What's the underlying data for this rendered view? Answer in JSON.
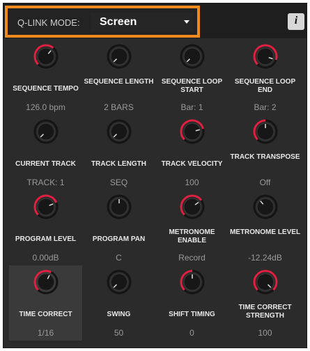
{
  "header": {
    "mode_label": "Q-LINK MODE:",
    "mode_value": "Screen",
    "info_label": "i"
  },
  "colors": {
    "highlight": "#f08a1d",
    "knob_active": "#e02040",
    "panel_bg": "#2b2b2b"
  },
  "knobs": [
    {
      "label": "SEQUENCE TEMPO",
      "value": "126.0 bpm",
      "level": 0.65,
      "red": true
    },
    {
      "label": "SEQUENCE LENGTH",
      "value": "2 BARS",
      "level": 0.0,
      "red": false
    },
    {
      "label": "SEQUENCE LOOP START",
      "value": "Bar: 1",
      "level": 0.0,
      "red": false
    },
    {
      "label": "SEQUENCE LOOP END",
      "value": "Bar: 2",
      "level": 0.9,
      "red": true
    },
    {
      "label": "CURRENT TRACK",
      "value": "TRACK: 1",
      "level": 0.0,
      "red": false
    },
    {
      "label": "TRACK LENGTH",
      "value": "SEQ",
      "level": 0.0,
      "red": false
    },
    {
      "label": "TRACK VELOCITY",
      "value": "100",
      "level": 0.78,
      "red": true
    },
    {
      "label": "TRACK TRANSPOSE",
      "value": "Off",
      "level": 0.5,
      "red": true
    },
    {
      "label": "PROGRAM LEVEL",
      "value": "0.00dB",
      "level": 0.75,
      "red": true
    },
    {
      "label": "PROGRAM PAN",
      "value": "C",
      "level": 0.5,
      "red": false
    },
    {
      "label": "METRONOME ENABLE",
      "value": "Record",
      "level": 0.7,
      "red": true
    },
    {
      "label": "METRONOME LEVEL",
      "value": "-12.24dB",
      "level": 0.35,
      "red": false
    },
    {
      "label": "TIME CORRECT",
      "value": "1/16",
      "level": 0.6,
      "red": true,
      "selected": true
    },
    {
      "label": "SWING",
      "value": "50",
      "level": 0.0,
      "red": false
    },
    {
      "label": "SHIFT TIMING",
      "value": "0",
      "level": 0.5,
      "red": true
    },
    {
      "label": "TIME CORRECT STRENGTH",
      "value": "100",
      "level": 1.0,
      "red": true
    }
  ]
}
